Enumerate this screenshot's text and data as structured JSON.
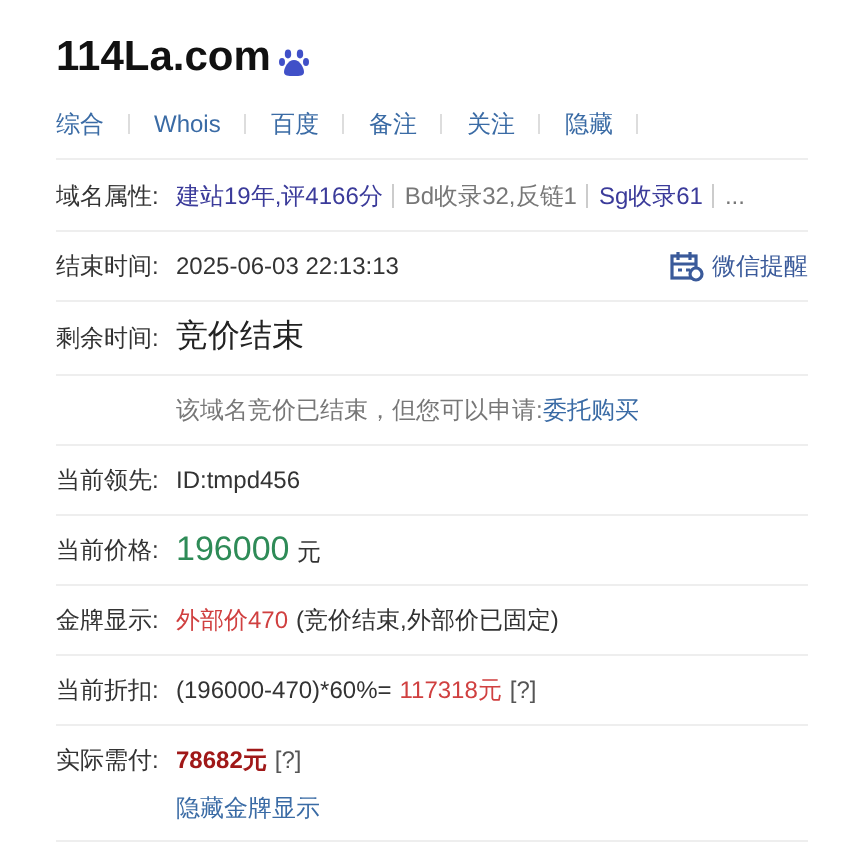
{
  "domain": "114La.com",
  "nav": [
    "综合",
    "Whois",
    "百度",
    "备注",
    "关注",
    "隐藏"
  ],
  "attributes": {
    "label": "域名属性:",
    "items": [
      {
        "text": "建站19年,评4166分",
        "kind": "link"
      },
      {
        "text": "Bd收录32,反链1",
        "kind": "muted"
      },
      {
        "text": "Sg收录61",
        "kind": "link"
      },
      {
        "text": "...",
        "kind": "muted"
      }
    ]
  },
  "end_time": {
    "label": "结束时间:",
    "value": "2025-06-03 22:13:13",
    "reminder": "微信提醒"
  },
  "remaining": {
    "label": "剩余时间:",
    "value": "竞价结束"
  },
  "notice": {
    "text": "该域名竞价已结束，但您可以申请:",
    "link": "委托购买"
  },
  "rows": [
    {
      "label": "当前领先:",
      "parts": [
        {
          "text": "ID:tmpd456",
          "kind": "plain"
        }
      ]
    },
    {
      "label": "当前价格:",
      "parts": [
        {
          "text": "196000",
          "kind": "price"
        },
        {
          "text": "元",
          "kind": "plain"
        }
      ]
    },
    {
      "label": "金牌显示:",
      "parts": [
        {
          "text": "外部价470",
          "kind": "red"
        },
        {
          "text": "(竞价结束,外部价已固定)",
          "kind": "plain"
        }
      ]
    },
    {
      "label": "当前折扣:",
      "parts": [
        {
          "text": "(196000-470)*60%=",
          "kind": "plain"
        },
        {
          "text": "117318元",
          "kind": "red"
        },
        {
          "text": "[?]",
          "kind": "help"
        }
      ]
    },
    {
      "label": "实际需付:",
      "parts": [
        {
          "text": "78682元",
          "kind": "bold"
        },
        {
          "text": "[?]",
          "kind": "help"
        }
      ],
      "link": "隐藏金牌显示"
    }
  ]
}
